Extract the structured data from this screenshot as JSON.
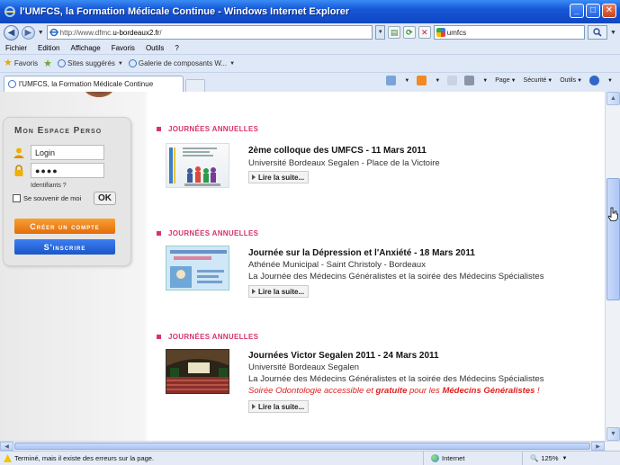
{
  "window": {
    "title": "l'UMFCS, la Formation Médicale Continue - Windows Internet Explorer"
  },
  "addressbar": {
    "url_prefix": "http://www.dfmc.",
    "url_domain": "u-bordeaux2.fr",
    "url_suffix": "/",
    "search_value": "umfcs"
  },
  "menu": [
    "Fichier",
    "Edition",
    "Affichage",
    "Favoris",
    "Outils",
    "?"
  ],
  "favorites": {
    "label": "Favoris",
    "items": [
      "Sites suggérés",
      "Galerie de composants W..."
    ]
  },
  "tab": {
    "label": "l'UMFCS, la Formation Médicale Continue"
  },
  "commandbar": {
    "page": "Page",
    "security": "Sécurité",
    "tools": "Outils"
  },
  "login_panel": {
    "title": "Mon Espace Perso",
    "login_value": "Login",
    "password_value": "●●●●",
    "identifiants": "Identifiants ?",
    "remember": "Se souvenir de moi",
    "ok": "OK",
    "create_account": "Créer un compte",
    "register": "S'inscrire"
  },
  "articles": [
    {
      "section": "JOURNÉES ANNUELLES",
      "title": "2ème colloque des UMFCS - 11 Mars 2011",
      "line1": "Université Bordeaux Segalen - Place de la Victoire",
      "more": "Lire la suite..."
    },
    {
      "section": "JOURNÉES ANNUELLES",
      "title": "Journée sur la Dépression et l'Anxiété - 18 Mars 2011",
      "line1": "Athénée Municipal - Saint Christoly - Bordeaux",
      "line2": "La Journée des Médecins Généralistes et la soirée des Médecins Spécialistes",
      "more": "Lire la suite..."
    },
    {
      "section": "JOURNÉES ANNUELLES",
      "title": "Journées Victor Segalen 2011 - 24 Mars 2011",
      "line1": "Université Bordeaux Segalen",
      "line2": "La Journée des Médecins Généralistes et la soirée des Médecins Spécialistes",
      "red_a": "Soirée Odontologie accessible et ",
      "red_b": "gratuite",
      "red_c": " pour les ",
      "red_d": "Médecins Généralistes",
      "red_e": " !",
      "more": "Lire la suite..."
    }
  ],
  "statusbar": {
    "message": "Terminé, mais il existe des erreurs sur la page.",
    "zone": "Internet",
    "zoom": "125%"
  }
}
